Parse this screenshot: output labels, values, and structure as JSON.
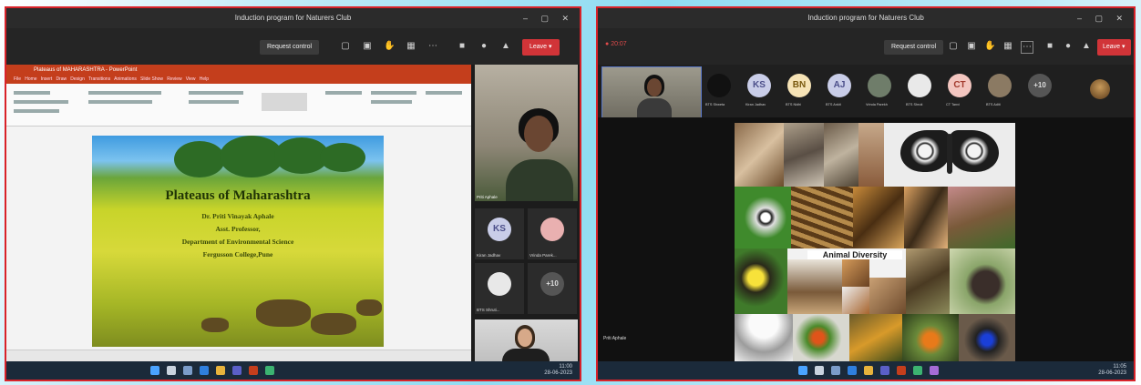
{
  "left_window": {
    "title": "Induction program for Naturers Club",
    "request_control": "Request control",
    "leave": "Leave",
    "ppt": {
      "file_title": "Plateaus of MAHARASHTRA - PowerPoint",
      "tabs": [
        "File",
        "Home",
        "Insert",
        "Draw",
        "Design",
        "Transitions",
        "Animations",
        "Slide Show",
        "Review",
        "View",
        "Help"
      ],
      "slide": {
        "heading": "Plateaus of Maharashtra",
        "lines": [
          "Dr. Priti Vinayak Aphale",
          "Asst. Professor,",
          "Department of Environmental Science",
          "Fergusson College,Pune"
        ]
      }
    },
    "participants": [
      {
        "initials": "KS",
        "name": "Kiran Jadhav",
        "color": "#c9cde8",
        "text_color": "#4c4f8a"
      },
      {
        "initials": "",
        "name": "Vrinda Parek...",
        "color": "#e9b0b0",
        "text_color": "#ffffff"
      },
      {
        "initials": "",
        "name": "BTS Shruti...",
        "color": "#e8e8e8",
        "text_color": "#333333"
      },
      {
        "initials": "+10",
        "name": "",
        "color": "#555555",
        "text_color": "#dddddd"
      }
    ],
    "presenter_label": "Priti Aphale",
    "tray_time": "11:00",
    "tray_date": "28-06-2023"
  },
  "right_window": {
    "title": "Induction program for Naturers Club",
    "meeting_time": "20:07",
    "request_control": "Request control",
    "leave": "Leave",
    "strip_participants": [
      {
        "initials": "",
        "name": "BTS Shweta",
        "color": "#111111",
        "text_color": "#ffffff"
      },
      {
        "initials": "KS",
        "name": "Kiran Jadhav",
        "color": "#c9cde8",
        "text_color": "#4c4f8a"
      },
      {
        "initials": "BN",
        "name": "BTS Nidhi",
        "color": "#f6e3b6",
        "text_color": "#7a5a10"
      },
      {
        "initials": "AJ",
        "name": "BTS Ankit",
        "color": "#c9cde8",
        "text_color": "#4c4f8a"
      },
      {
        "initials": "",
        "name": "Vrinda Parekh",
        "color": "#6f7d6a",
        "text_color": "#ffffff"
      },
      {
        "initials": "",
        "name": "BTS Shruti",
        "color": "#e9e9e9",
        "text_color": "#111111"
      },
      {
        "initials": "CT",
        "name": "CT Tanvi",
        "color": "#f3c6c0",
        "text_color": "#a33b2e"
      },
      {
        "initials": "",
        "name": "BTS Aditi",
        "color": "#8b7a63",
        "text_color": "#ffffff"
      },
      {
        "initials": "+10",
        "name": "",
        "color": "#555555",
        "text_color": "#dddddd"
      }
    ],
    "collage_label": "Animal Diversity",
    "presenter_label": "Priti Aphale",
    "tray_time": "11:05",
    "tray_date": "28-06-2023"
  }
}
